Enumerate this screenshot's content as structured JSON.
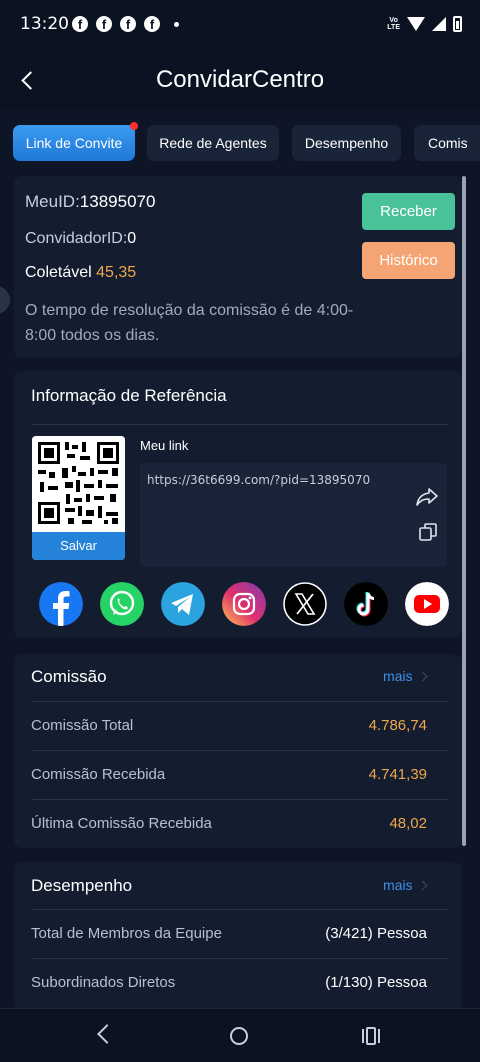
{
  "status": {
    "time": "13:20",
    "network": "Vo LTE"
  },
  "header": {
    "title": "ConvidarCentro"
  },
  "tabs": [
    {
      "label": "Link de Convite",
      "active": true
    },
    {
      "label": "Rede de Agentes"
    },
    {
      "label": "Desempenho"
    },
    {
      "label": "Comis"
    }
  ],
  "summary": {
    "meu_id_label": "MeuID:",
    "meu_id": "13895070",
    "convidador_label": "ConvidadorID:",
    "convidador_id": "0",
    "coletavel_label": "Coletável",
    "coletavel_value": "45,35",
    "receber_button": "Receber",
    "historico_button": "Histórico",
    "note": "O tempo de resolução da comissão é de 4:00-8:00 todos os dias."
  },
  "referral": {
    "title": "Informação de Referência",
    "save_label": "Salvar",
    "link_label": "Meu link",
    "link_url": "https://36t6699.com/?pid=13895070",
    "socials": [
      {
        "icon": "facebook-icon",
        "color": "#1877f2"
      },
      {
        "icon": "whatsapp-icon",
        "color": "#25d366"
      },
      {
        "icon": "telegram-icon",
        "color": "#2aa3df"
      },
      {
        "icon": "instagram-icon",
        "color": "#e1306c"
      },
      {
        "icon": "x-icon",
        "color": "#000000"
      },
      {
        "icon": "tiktok-icon",
        "color": "#000000"
      },
      {
        "icon": "youtube-icon",
        "color": "#ff0000"
      }
    ]
  },
  "commission": {
    "title": "Comissão",
    "more": "mais",
    "rows": [
      {
        "label": "Comissão Total",
        "value": "4.786,74"
      },
      {
        "label": "Comissão Recebida",
        "value": "4.741,39"
      },
      {
        "label": "Última Comissão Recebida",
        "value": "48,02"
      }
    ]
  },
  "performance": {
    "title": "Desempenho",
    "more": "mais",
    "rows": [
      {
        "label": "Total de Membros da Equipe",
        "value": "(3/421) Pessoa"
      },
      {
        "label": "Subordinados Diretos",
        "value": "(1/130) Pessoa"
      }
    ]
  },
  "colors": {
    "accent": "#1f78d6",
    "orange": "#f0a64a",
    "green": "#49c29a",
    "link": "#3d8ee6"
  }
}
